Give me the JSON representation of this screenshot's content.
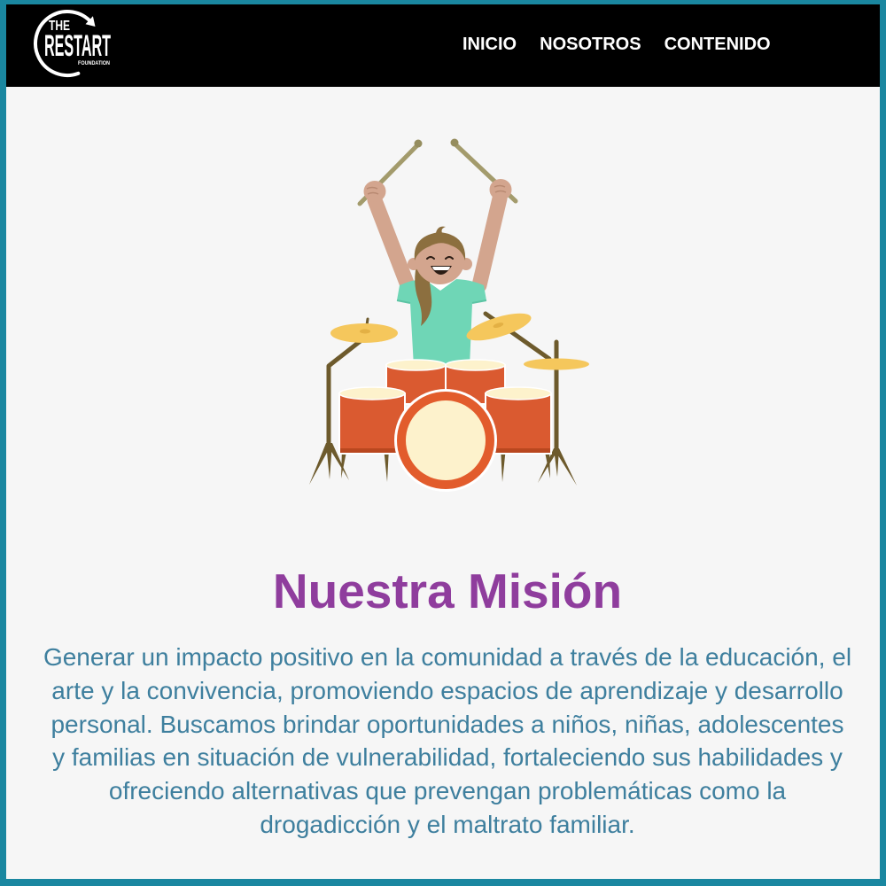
{
  "colors": {
    "frame": "#1a87a0",
    "header_bg": "#000000",
    "page_bg": "#f6f6f6",
    "nav_text": "#ffffff",
    "title": "#8f3d9d",
    "body_text": "#3e7f9e"
  },
  "header": {
    "logo": {
      "icon": "restart-arrow-icon",
      "line1": "THE",
      "line2": "RESTART",
      "line3": "FOUNDATION"
    },
    "nav": [
      {
        "label": "INICIO"
      },
      {
        "label": "NOSOTROS"
      },
      {
        "label": "CONTENIDO"
      }
    ]
  },
  "hero": {
    "icon": "drums-illustration"
  },
  "mission": {
    "title": "Nuestra Misión",
    "lines": [
      "Generar un impacto positivo en la comunidad a través de la educación, el",
      "arte y la convivencia, promoviendo espacios de aprendizaje y desarrollo",
      "personal. Buscamos brindar oportunidades a niños, niñas, adolescentes",
      "y familias en situación de vulnerabilidad, fortaleciendo sus habilidades y",
      "ofreciendo alternativas que prevengan problemáticas como la",
      "drogadicción y el maltrato familiar."
    ]
  }
}
